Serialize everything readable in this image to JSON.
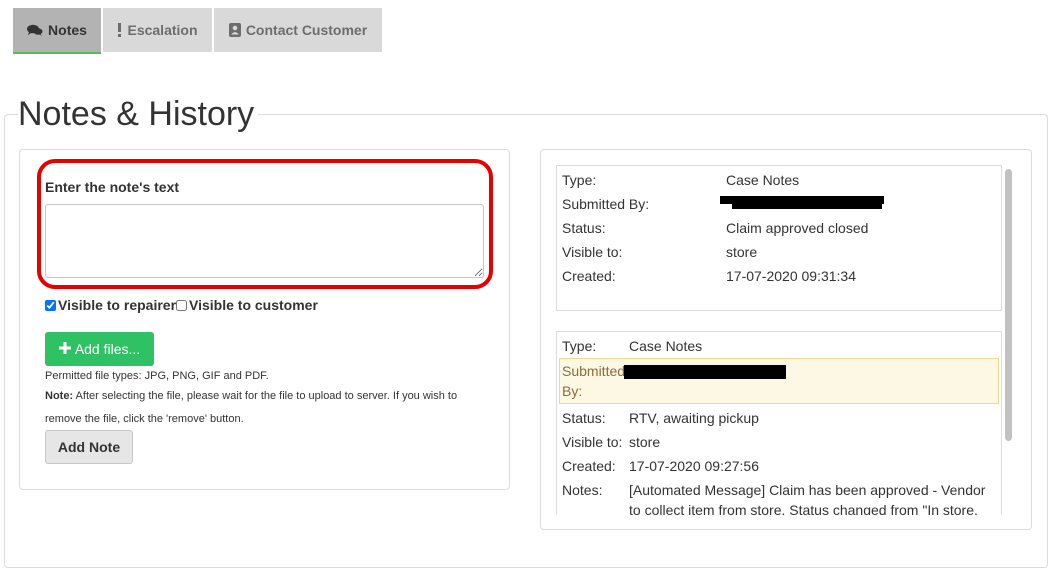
{
  "tabs": [
    {
      "label": "Notes",
      "icon": "comments-icon",
      "active": true
    },
    {
      "label": "Escalation",
      "icon": "exclamation-icon",
      "active": false
    },
    {
      "label": "Contact Customer",
      "icon": "contact-card-icon",
      "active": false
    }
  ],
  "section_title": "Notes & History",
  "note_form": {
    "label": "Enter the note's text",
    "text_value": "",
    "visible_repairer_label": "Visible to repairer",
    "visible_repairer_checked": true,
    "visible_customer_label": "Visible to customer",
    "visible_customer_checked": false,
    "add_files_label": "Add files...",
    "permitted_types": "Permitted file types: JPG, PNG, GIF and PDF.",
    "note_prefix": "Note:",
    "note_line1": " After selecting the file, please wait for the file to upload to server. If you wish to",
    "note_line2": "remove the file, click the 'remove' button.",
    "add_note_label": "Add Note",
    "accent_color": "#2fc264",
    "highlight_color": "#e60000"
  },
  "history": [
    {
      "type_label": "Type:",
      "type_value": "Case Notes",
      "submitted_label": "Submitted By:",
      "submitted_redacted": true,
      "status_label": "Status:",
      "status_value": "Claim approved closed",
      "visible_label": "Visible to:",
      "visible_value": "store",
      "created_label": "Created:",
      "created_value": "17-07-2020 09:31:34"
    },
    {
      "type_label": "Type:",
      "type_value": "Case Notes",
      "submitted_label_line1": "Submitted",
      "submitted_label_line2": "By:",
      "submitted_redacted": true,
      "status_label": "Status:",
      "status_value": "RTV, awaiting pickup",
      "visible_label": "Visible to:",
      "visible_value": "store",
      "created_label": "Created:",
      "created_value": "17-07-2020 09:27:56",
      "notes_label": "Notes:",
      "notes_value": "[Automated Message] Claim has been approved - Vendor to collect item from store. Status changed from \"In store."
    }
  ]
}
